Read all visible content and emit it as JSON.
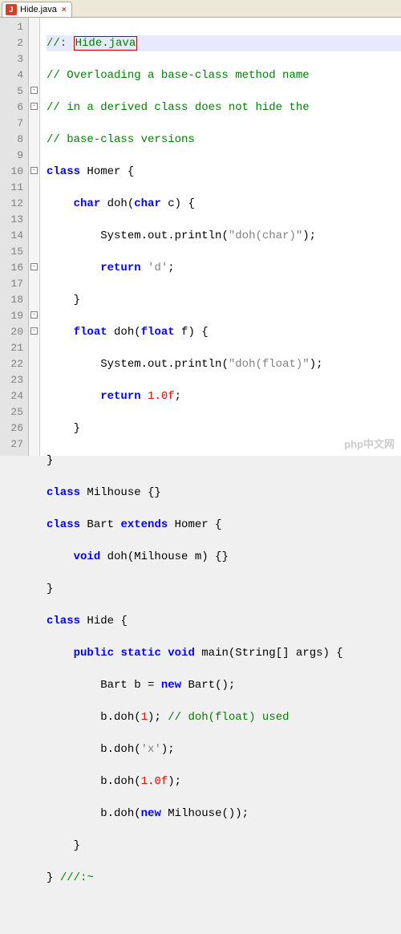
{
  "tab": {
    "filename": "Hide.java",
    "close_glyph": "×"
  },
  "line_numbers": [
    "1",
    "2",
    "3",
    "4",
    "5",
    "6",
    "7",
    "8",
    "9",
    "10",
    "11",
    "12",
    "13",
    "14",
    "15",
    "16",
    "17",
    "18",
    "19",
    "20",
    "21",
    "22",
    "23",
    "24",
    "25",
    "26",
    "27"
  ],
  "fold_marks": [
    "",
    "",
    "",
    "",
    "-",
    "-",
    "",
    "",
    "",
    "-",
    "",
    "",
    "",
    "",
    "",
    "-",
    "",
    "",
    "-",
    "-",
    "",
    "",
    "",
    "",
    "",
    "",
    ""
  ],
  "code": {
    "indent": {
      "i0": "",
      "i1": "    ",
      "i2": "        ",
      "i3": "            "
    },
    "l1": {
      "comment": "//: ",
      "boxed": "Hide.java"
    },
    "l2": {
      "comment": "// Overloading a base-class method name"
    },
    "l3": {
      "comment": "// in a derived class does not hide the"
    },
    "l4": {
      "comment": "// base-class versions"
    },
    "l5": {
      "kw": "class",
      "rest": " Homer {"
    },
    "l6": {
      "kw": "char",
      "rest_a": " doh(",
      "kw2": "char",
      "rest_b": " c) {"
    },
    "l7": {
      "a": "System.out.println(",
      "str": "\"doh(char)\"",
      "b": ");"
    },
    "l8": {
      "kw": "return",
      "sp": " ",
      "ch": "'d'",
      "semi": ";"
    },
    "l9": {
      "brace": "}"
    },
    "l10": {
      "kw": "float",
      "rest_a": " doh(",
      "kw2": "float",
      "rest_b": " f) {"
    },
    "l11": {
      "a": "System.out.println(",
      "str": "\"doh(float)\"",
      "b": ");"
    },
    "l12": {
      "kw": "return",
      "sp": " ",
      "num": "1.0f",
      "semi": ";"
    },
    "l13": {
      "brace": "}"
    },
    "l14": {
      "brace": "}"
    },
    "l15": {
      "kw": "class",
      "rest": " Milhouse {}"
    },
    "l16": {
      "kw": "class",
      "mid": " Bart ",
      "kw2": "extends",
      "rest": " Homer {"
    },
    "l17": {
      "kw": "void",
      "rest": " doh(Milhouse m) {}"
    },
    "l18": {
      "brace": "}"
    },
    "l19": {
      "kw": "class",
      "rest": " Hide {"
    },
    "l20": {
      "kw1": "public",
      "sp1": " ",
      "kw2": "static",
      "sp2": " ",
      "kw3": "void",
      "rest": " main(String[] args) {"
    },
    "l21": {
      "a": "Bart b = ",
      "kw": "new",
      "b": " Bart();"
    },
    "l22": {
      "a": "b.doh(",
      "num": "1",
      "b": "); ",
      "comment": "// doh(float) used"
    },
    "l23": {
      "a": "b.doh(",
      "ch": "'x'",
      "b": ");"
    },
    "l24": {
      "a": "b.doh(",
      "num": "1.0f",
      "b": ");"
    },
    "l25": {
      "a": "b.doh(",
      "kw": "new",
      "b": " Milhouse());"
    },
    "l26": {
      "brace": "}"
    },
    "l27": {
      "a": "} ",
      "comment": "///:~"
    }
  },
  "watermark": "php中文网"
}
